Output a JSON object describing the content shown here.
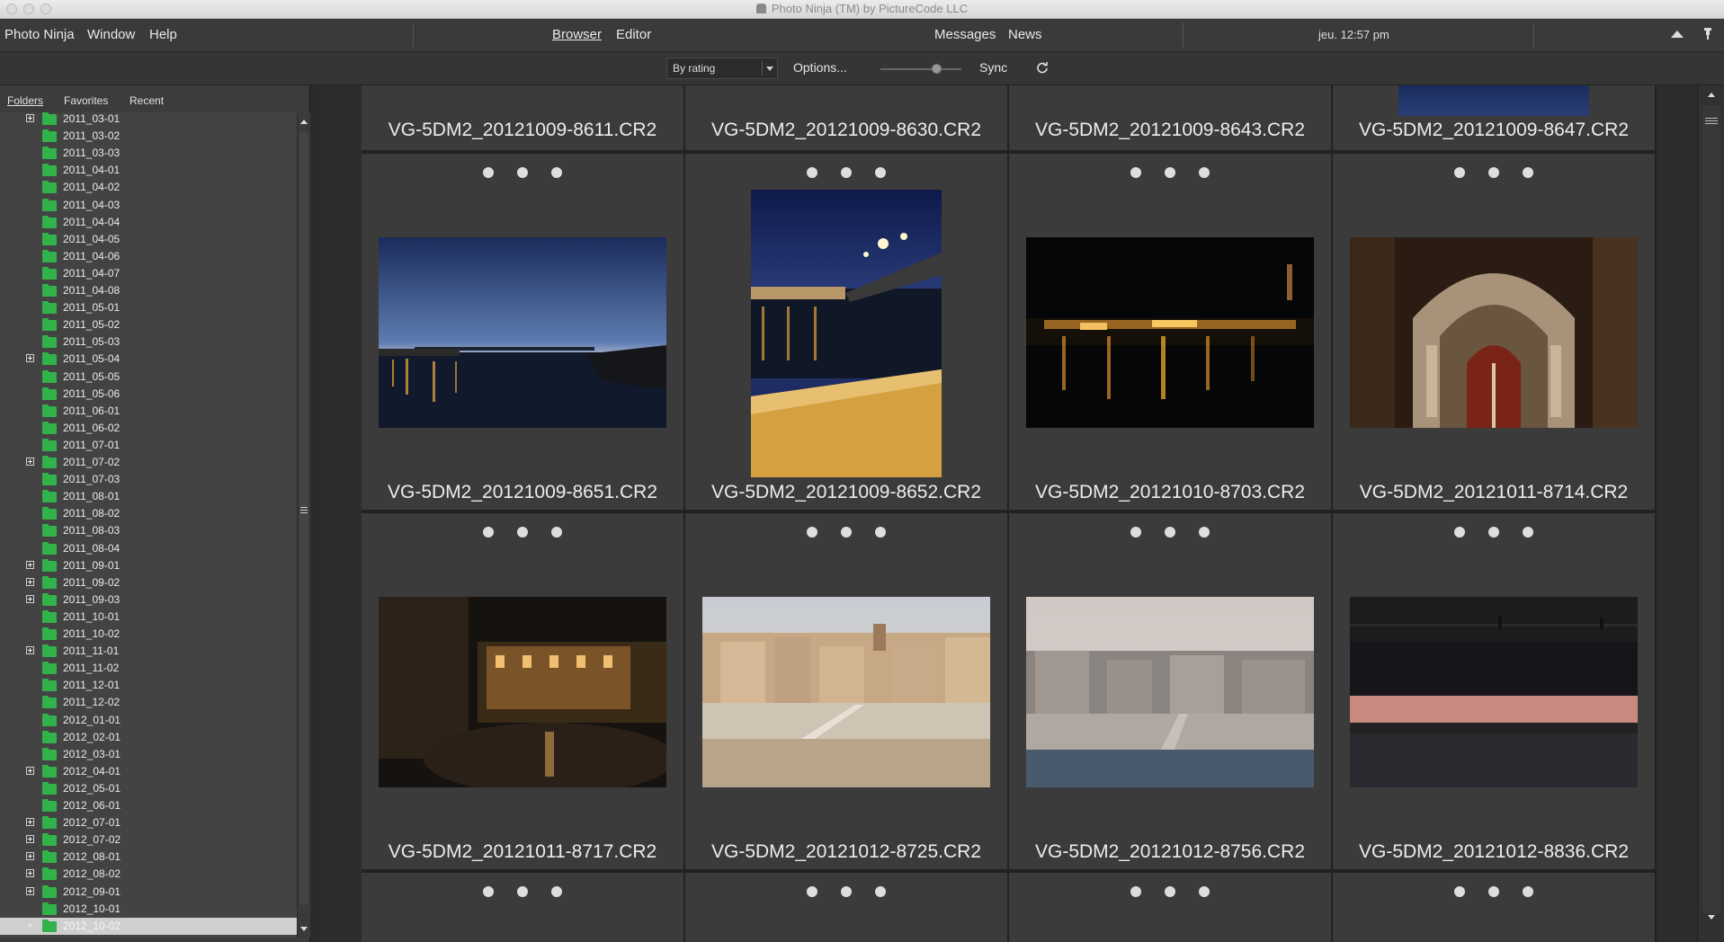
{
  "window": {
    "title": "Photo Ninja (TM) by PictureCode LLC"
  },
  "menubar": {
    "app": "Photo Ninja",
    "window": "Window",
    "help": "Help",
    "browser": "Browser",
    "editor": "Editor",
    "messages": "Messages",
    "news": "News",
    "clock": "jeu. 12:57 pm"
  },
  "toolbar": {
    "sort": "By rating",
    "options": "Options...",
    "zoom_level": 0.7,
    "sync": "Sync"
  },
  "panel_tabs": [
    "Folders",
    "Favorites",
    "Recent"
  ],
  "folders": [
    {
      "name": "2011_03-01",
      "expandable": true
    },
    {
      "name": "2011_03-02",
      "expandable": false
    },
    {
      "name": "2011_03-03",
      "expandable": false
    },
    {
      "name": "2011_04-01",
      "expandable": false
    },
    {
      "name": "2011_04-02",
      "expandable": false
    },
    {
      "name": "2011_04-03",
      "expandable": false
    },
    {
      "name": "2011_04-04",
      "expandable": false
    },
    {
      "name": "2011_04-05",
      "expandable": false
    },
    {
      "name": "2011_04-06",
      "expandable": false
    },
    {
      "name": "2011_04-07",
      "expandable": false
    },
    {
      "name": "2011_04-08",
      "expandable": false
    },
    {
      "name": "2011_05-01",
      "expandable": false
    },
    {
      "name": "2011_05-02",
      "expandable": false
    },
    {
      "name": "2011_05-03",
      "expandable": false
    },
    {
      "name": "2011_05-04",
      "expandable": true
    },
    {
      "name": "2011_05-05",
      "expandable": false
    },
    {
      "name": "2011_05-06",
      "expandable": false
    },
    {
      "name": "2011_06-01",
      "expandable": false
    },
    {
      "name": "2011_06-02",
      "expandable": false
    },
    {
      "name": "2011_07-01",
      "expandable": false
    },
    {
      "name": "2011_07-02",
      "expandable": true
    },
    {
      "name": "2011_07-03",
      "expandable": false
    },
    {
      "name": "2011_08-01",
      "expandable": false
    },
    {
      "name": "2011_08-02",
      "expandable": false
    },
    {
      "name": "2011_08-03",
      "expandable": false
    },
    {
      "name": "2011_08-04",
      "expandable": false
    },
    {
      "name": "2011_09-01",
      "expandable": true
    },
    {
      "name": "2011_09-02",
      "expandable": true
    },
    {
      "name": "2011_09-03",
      "expandable": true
    },
    {
      "name": "2011_10-01",
      "expandable": false
    },
    {
      "name": "2011_10-02",
      "expandable": false
    },
    {
      "name": "2011_11-01",
      "expandable": true
    },
    {
      "name": "2011_11-02",
      "expandable": false
    },
    {
      "name": "2011_12-01",
      "expandable": false
    },
    {
      "name": "2011_12-02",
      "expandable": false
    },
    {
      "name": "2012_01-01",
      "expandable": false
    },
    {
      "name": "2012_02-01",
      "expandable": false
    },
    {
      "name": "2012_03-01",
      "expandable": false
    },
    {
      "name": "2012_04-01",
      "expandable": true
    },
    {
      "name": "2012_05-01",
      "expandable": false
    },
    {
      "name": "2012_06-01",
      "expandable": false
    },
    {
      "name": "2012_07-01",
      "expandable": true
    },
    {
      "name": "2012_07-02",
      "expandable": true
    },
    {
      "name": "2012_08-01",
      "expandable": true
    },
    {
      "name": "2012_08-02",
      "expandable": true
    },
    {
      "name": "2012_09-01",
      "expandable": true
    },
    {
      "name": "2012_10-01",
      "expandable": false
    },
    {
      "name": "2012_10-02",
      "expandable": true,
      "selected": true
    }
  ],
  "thumbnails_top": [
    "VG-5DM2_20121009-8611.CR2",
    "VG-5DM2_20121009-8630.CR2",
    "VG-5DM2_20121009-8643.CR2",
    "VG-5DM2_20121009-8647.CR2"
  ],
  "thumbnails": [
    {
      "name": "VG-5DM2_20121009-8651.CR2",
      "scene": "dusk-river-bridge"
    },
    {
      "name": "VG-5DM2_20121009-8652.CR2",
      "scene": "bridge-lights-portrait"
    },
    {
      "name": "VG-5DM2_20121010-8703.CR2",
      "scene": "night-town-reflection"
    },
    {
      "name": "VG-5DM2_20121011-8714.CR2",
      "scene": "church-portal-night"
    },
    {
      "name": "VG-5DM2_20121011-8717.CR2",
      "scene": "night-square-fountain"
    },
    {
      "name": "VG-5DM2_20121012-8725.CR2",
      "scene": "riverside-houses-sunset"
    },
    {
      "name": "VG-5DM2_20121012-8756.CR2",
      "scene": "riverside-town-evening"
    },
    {
      "name": "VG-5DM2_20121012-8836.CR2",
      "scene": "bridge-silhouette"
    }
  ]
}
